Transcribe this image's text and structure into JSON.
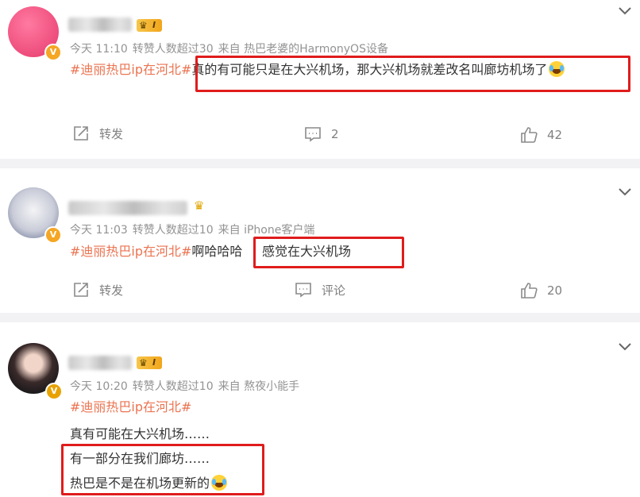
{
  "posts": [
    {
      "level": "I",
      "meta": {
        "time": "今天 11:10",
        "reposts": "转赞人数超过30",
        "source": "来自 热巴老婆的HarmonyOS设备"
      },
      "hashtag": "#迪丽热巴ip在河北#",
      "lines": [
        "真的有可能只是在大兴机场，那大兴机场就差改名叫廊坊机场了"
      ],
      "actions": {
        "repost": "转发",
        "comment": "2",
        "like": "42"
      }
    },
    {
      "level": "",
      "meta": {
        "time": "今天 11:03",
        "reposts": "转赞人数超过10",
        "source": "来自 iPhone客户端"
      },
      "hashtag": "#迪丽热巴ip在河北#",
      "lines": [
        "啊哈哈哈",
        "感觉在大兴机场"
      ],
      "actions": {
        "repost": "转发",
        "comment": "评论",
        "like": "20"
      }
    },
    {
      "level": "I",
      "meta": {
        "time": "今天 10:20",
        "reposts": "转赞人数超过10",
        "source": "来自 熬夜小能手"
      },
      "hashtag": "#迪丽热巴ip在河北#",
      "lines": [
        "真有可能在大兴机场……",
        "有一部分在我们廊坊……",
        "热巴是不是在机场更新的"
      ]
    }
  ],
  "colors": {
    "hashtag": "#eb7350",
    "highlight": "#e01c1c",
    "badge": "#f5a623"
  },
  "icons": [
    "chevron-down-icon",
    "repost-icon",
    "comment-icon",
    "like-icon",
    "crown-icon",
    "verified-badge-icon",
    "crying-laughing-emoji"
  ]
}
